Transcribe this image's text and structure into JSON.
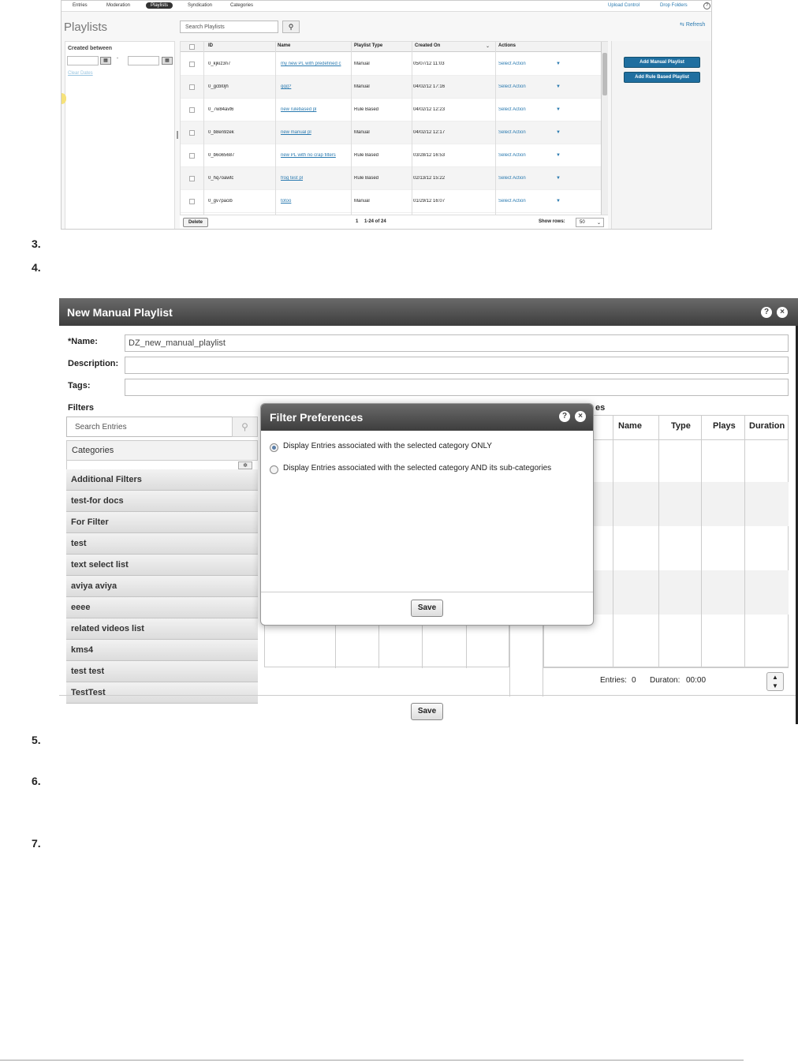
{
  "screenshot1": {
    "nav": {
      "tabs": [
        "Entries",
        "Moderation",
        "Playlists",
        "Syndication",
        "Categories"
      ],
      "active_tab": "Playlists",
      "right_links": [
        "Upload Control",
        "Drop Folders"
      ],
      "help": "?"
    },
    "title": "Playlists",
    "search_placeholder": "Search Playlists",
    "refresh_label": "Refresh",
    "filter": {
      "created_between_label": "Created between",
      "dash": "-",
      "clear_dates": "Clear Dates"
    },
    "table": {
      "headers": [
        "ID",
        "Name",
        "Playlist Type",
        "Created On",
        "Actions"
      ],
      "rows": [
        {
          "id": "0_kjkiz3n7",
          "name": "my new PL with predefined c",
          "type": "Manual",
          "created": "05/07/12 11:03",
          "action": "Select Action"
        },
        {
          "id": "0_gcbl0jh",
          "name": "qqq?",
          "type": "Manual",
          "created": "04/02/12 17:16",
          "action": "Select Action"
        },
        {
          "id": "0_7w84avt6",
          "name": "new rulebased pl",
          "type": "Rule Based",
          "created": "04/02/12 12:23",
          "action": "Select Action"
        },
        {
          "id": "0_b8en9zek",
          "name": "new manual pl",
          "type": "Manual",
          "created": "04/02/12 12:17",
          "action": "Select Action"
        },
        {
          "id": "0_b6o65687",
          "name": "new PL with no crap filters",
          "type": "Rule Based",
          "created": "03/28/12 16:53",
          "action": "Select Action"
        },
        {
          "id": "0_hq7oawtc",
          "name": "frog test pl",
          "type": "Rule Based",
          "created": "02/13/12 15:22",
          "action": "Select Action"
        },
        {
          "id": "0_gv7pacib",
          "name": "totoo",
          "type": "Manual",
          "created": "01/29/12 16:07",
          "action": "Select Action"
        }
      ]
    },
    "buttons": {
      "add_manual": "Add Manual Playlist",
      "add_rule": "Add Rule Based Playlist",
      "delete": "Delete"
    },
    "pager": {
      "page": "1",
      "range": "1-24 of 24",
      "show_rows_label": "Show rows:",
      "show_rows_value": "50"
    }
  },
  "steps": [
    "3.",
    "4.",
    "5.",
    "6.",
    "7."
  ],
  "screenshot2": {
    "title": "New Manual Playlist",
    "help": "?",
    "close": "×",
    "fields": {
      "name_label": "*Name:",
      "name_value": "DZ_new_manual_playlist",
      "description_label": "Description:",
      "tags_label": "Tags:"
    },
    "filters": {
      "label": "Filters",
      "search_placeholder": "Search Entries",
      "categories_label": "Categories",
      "items": [
        "Additional Filters",
        "test-for docs",
        "For Filter",
        "test",
        "text select list",
        "aviya aviya",
        "eeee",
        "related videos list",
        "kms4",
        "test test",
        "TestTest"
      ]
    },
    "grid": {
      "partial_heading": "es",
      "headers": [
        "Name",
        "Type",
        "Plays",
        "Duration"
      ]
    },
    "summary": {
      "entries_label": "Entries:",
      "entries_value": "0",
      "duration_label": "Duraton:",
      "duration_value": "00:00"
    },
    "save_label": "Save"
  },
  "filter_prefs": {
    "title": "Filter Preferences",
    "options": [
      {
        "label": "Display Entries associated with the selected category ONLY",
        "selected": true
      },
      {
        "label": "Display Entries associated with the selected category AND its sub-categories",
        "selected": false
      }
    ],
    "save_label": "Save"
  }
}
